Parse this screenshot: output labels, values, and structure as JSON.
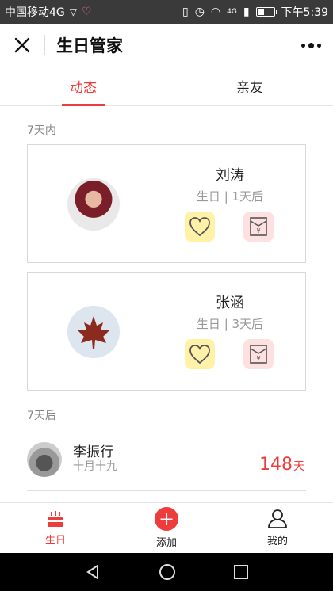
{
  "statusbar": {
    "carrier": "中国移动4G",
    "network": "4G",
    "time": "下午5:39"
  },
  "header": {
    "title": "生日管家"
  },
  "tabs": [
    {
      "label": "动态",
      "active": true
    },
    {
      "label": "亲友",
      "active": false
    }
  ],
  "sections": {
    "within7": "7天内",
    "after7": "7天后"
  },
  "cards": [
    {
      "name": "刘涛",
      "sub": "生日 | 1天后"
    },
    {
      "name": "张涵",
      "sub": "生日 | 3天后"
    }
  ],
  "list": [
    {
      "name": "李振行",
      "date": "十月十九",
      "days": "148",
      "unit": "天"
    }
  ],
  "bottomnav": {
    "birthday": "生日",
    "add": "添加",
    "mine": "我的"
  },
  "colors": {
    "accent": "#ee3b3b",
    "like_bg": "#fff2a8",
    "gift_bg": "#fde0e0"
  }
}
